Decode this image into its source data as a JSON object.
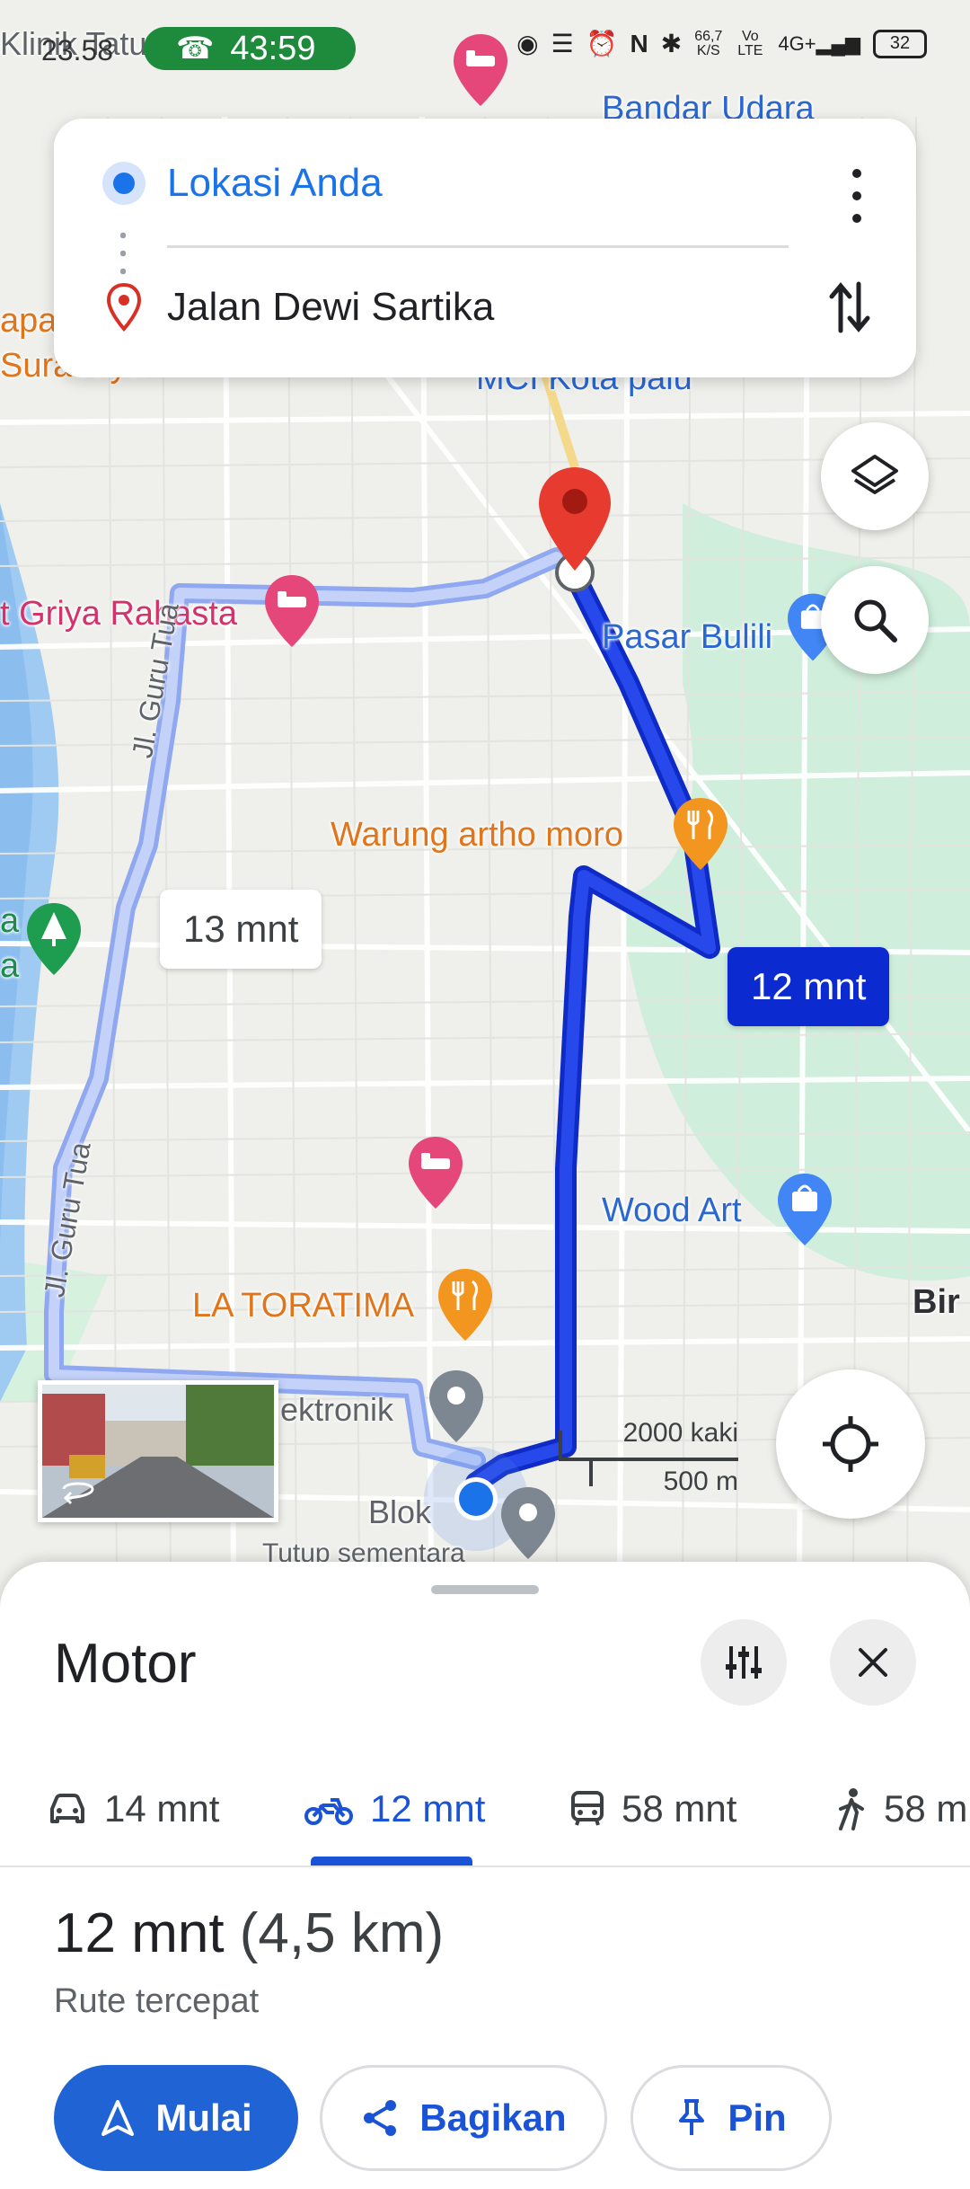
{
  "status_bar": {
    "time": "23.58",
    "call_timer": "43:59",
    "speed_value": "66,7",
    "speed_unit": "K/S",
    "network": "4G+",
    "volte": "Vo LTE",
    "battery": "32"
  },
  "route_card": {
    "origin": "Lokasi Anda",
    "destination": "Jalan Dewi Sartika"
  },
  "map": {
    "labels": {
      "klinik": "Klinik Tatu",
      "bandara": "Bandar Udara",
      "apa": "apa",
      "surabaya": "Surabaya",
      "mci": "MCI Kota palu",
      "griya": "t Griya Rahasta",
      "pasar": "Pasar Bulili",
      "warung": "Warung artho moro",
      "jl1": "Jl. Guru Tua",
      "jl2": "Jl. Guru Tua",
      "wood": "Wood Art",
      "la_toratima": "LA TORATIMA",
      "bir": "Bir",
      "ektronik": "ektronik",
      "blok": "Blok",
      "tutup": "Tutup sementara",
      "a1": "a",
      "a2": "a"
    },
    "eta_alt": "13 mnt",
    "eta_main": "12 mnt",
    "scale_imperial": "2000 kaki",
    "scale_metric": "500 m",
    "colors": {
      "route_main": "#1a3fe0",
      "route_alt": "#a9bcf5",
      "water": "#9cc7f0",
      "park": "#c9ecd6"
    }
  },
  "sheet": {
    "title": "Motor",
    "modes": [
      {
        "icon": "car-icon",
        "label": "14 mnt"
      },
      {
        "icon": "motorcycle-icon",
        "label": "12 mnt"
      },
      {
        "icon": "transit-icon",
        "label": "58 mnt"
      },
      {
        "icon": "walk-icon",
        "label": "58 m"
      }
    ],
    "summary_time": "12 mnt",
    "summary_distance": "(4,5 km)",
    "subtitle": "Rute tercepat",
    "buttons": {
      "start": "Mulai",
      "share": "Bagikan",
      "pin": "Pin"
    }
  }
}
